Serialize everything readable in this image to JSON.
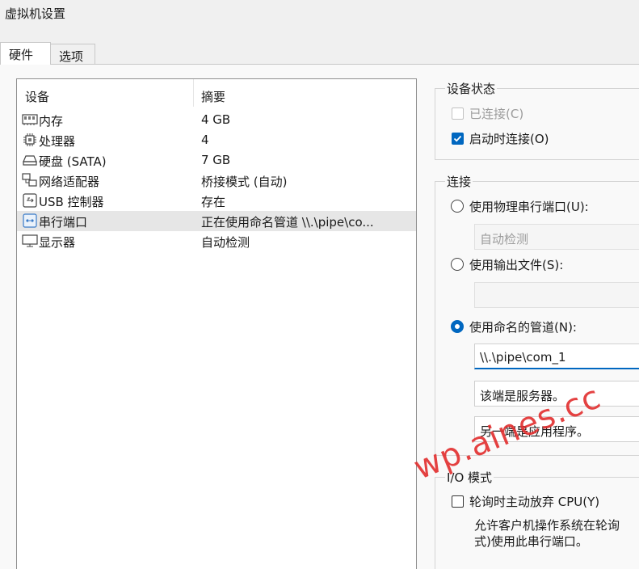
{
  "window": {
    "title": "虚拟机设置"
  },
  "tabs": [
    {
      "label": "硬件",
      "active": true
    },
    {
      "label": "选项",
      "active": false
    }
  ],
  "device_list": {
    "headers": {
      "device": "设备",
      "summary": "摘要"
    },
    "rows": [
      {
        "icon": "memory-icon",
        "name": "内存",
        "summary": "4 GB"
      },
      {
        "icon": "processor-icon",
        "name": "处理器",
        "summary": "4"
      },
      {
        "icon": "hard-disk-icon",
        "name": "硬盘 (SATA)",
        "summary": "7 GB"
      },
      {
        "icon": "network-adapter-icon",
        "name": "网络适配器",
        "summary": "桥接模式 (自动)"
      },
      {
        "icon": "usb-controller-icon",
        "name": "USB 控制器",
        "summary": "存在"
      },
      {
        "icon": "serial-port-icon",
        "name": "串行端口",
        "summary": "正在使用命名管道 \\\\.\\pipe\\co...",
        "selected": true
      },
      {
        "icon": "display-icon",
        "name": "显示器",
        "summary": "自动检测"
      }
    ]
  },
  "device_status": {
    "title": "设备状态",
    "connected_label": "已连接(C)",
    "connected_checked": false,
    "connect_on_start_label": "启动时连接(O)",
    "connect_on_start_checked": true
  },
  "connection": {
    "title": "连接",
    "physical_port_label": "使用物理串行端口(U):",
    "physical_port_value": "自动检测",
    "output_file_label": "使用输出文件(S):",
    "output_file_value": "",
    "named_pipe_label": "使用命名的管道(N):",
    "named_pipe_value": "\\\\.\\pipe\\com_1",
    "pipe_end_value": "该端是服务器。",
    "other_end_value": "另一端是应用程序。",
    "selected": "named_pipe"
  },
  "io_mode": {
    "title": "I/O 模式",
    "polling_label": "轮询时主动放弃 CPU(Y)",
    "polling_checked": false,
    "description_line1": "允许客户机操作系统在轮询",
    "description_line2": "式)使用此串行端口。"
  },
  "watermark": "wp.aines.cc",
  "colors": {
    "accent": "#0067c0",
    "watermark": "#e22e2e",
    "selected_row": "#e6e6e6"
  }
}
